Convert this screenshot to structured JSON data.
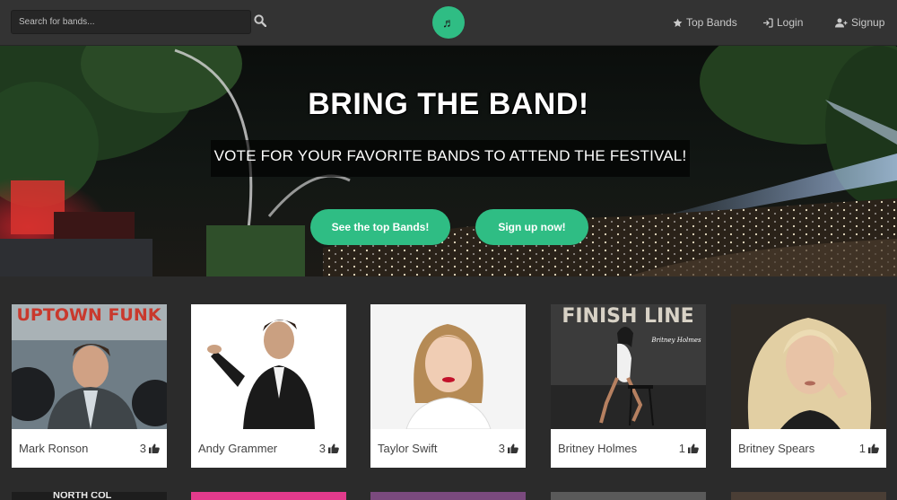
{
  "search": {
    "placeholder": "Search for bands..."
  },
  "nav": {
    "logo_glyph": "♬",
    "top_bands": "Top Bands",
    "login": "Login",
    "signup": "Signup"
  },
  "hero": {
    "title": "BRING THE BAND!",
    "subtitle": "VOTE FOR YOUR FAVORITE BANDS TO ATTEND THE FESTIVAL!",
    "btn_top": "See the top Bands!",
    "btn_signup": "Sign up now!"
  },
  "bands": [
    {
      "name": "Mark Ronson",
      "votes": "3",
      "poster": "UPTOWN FUNK"
    },
    {
      "name": "Andy Grammer",
      "votes": "3"
    },
    {
      "name": "Taylor Swift",
      "votes": "3"
    },
    {
      "name": "Britney Holmes",
      "votes": "1",
      "poster": "FINISH LINE",
      "signature": "Britney Holmes"
    },
    {
      "name": "Britney Spears",
      "votes": "1"
    }
  ],
  "row2": {
    "partial_text": "NORTH COL"
  },
  "colors": {
    "accent": "#2fbd84",
    "navbar": "#333333",
    "page_bg": "#2b2b2b"
  }
}
